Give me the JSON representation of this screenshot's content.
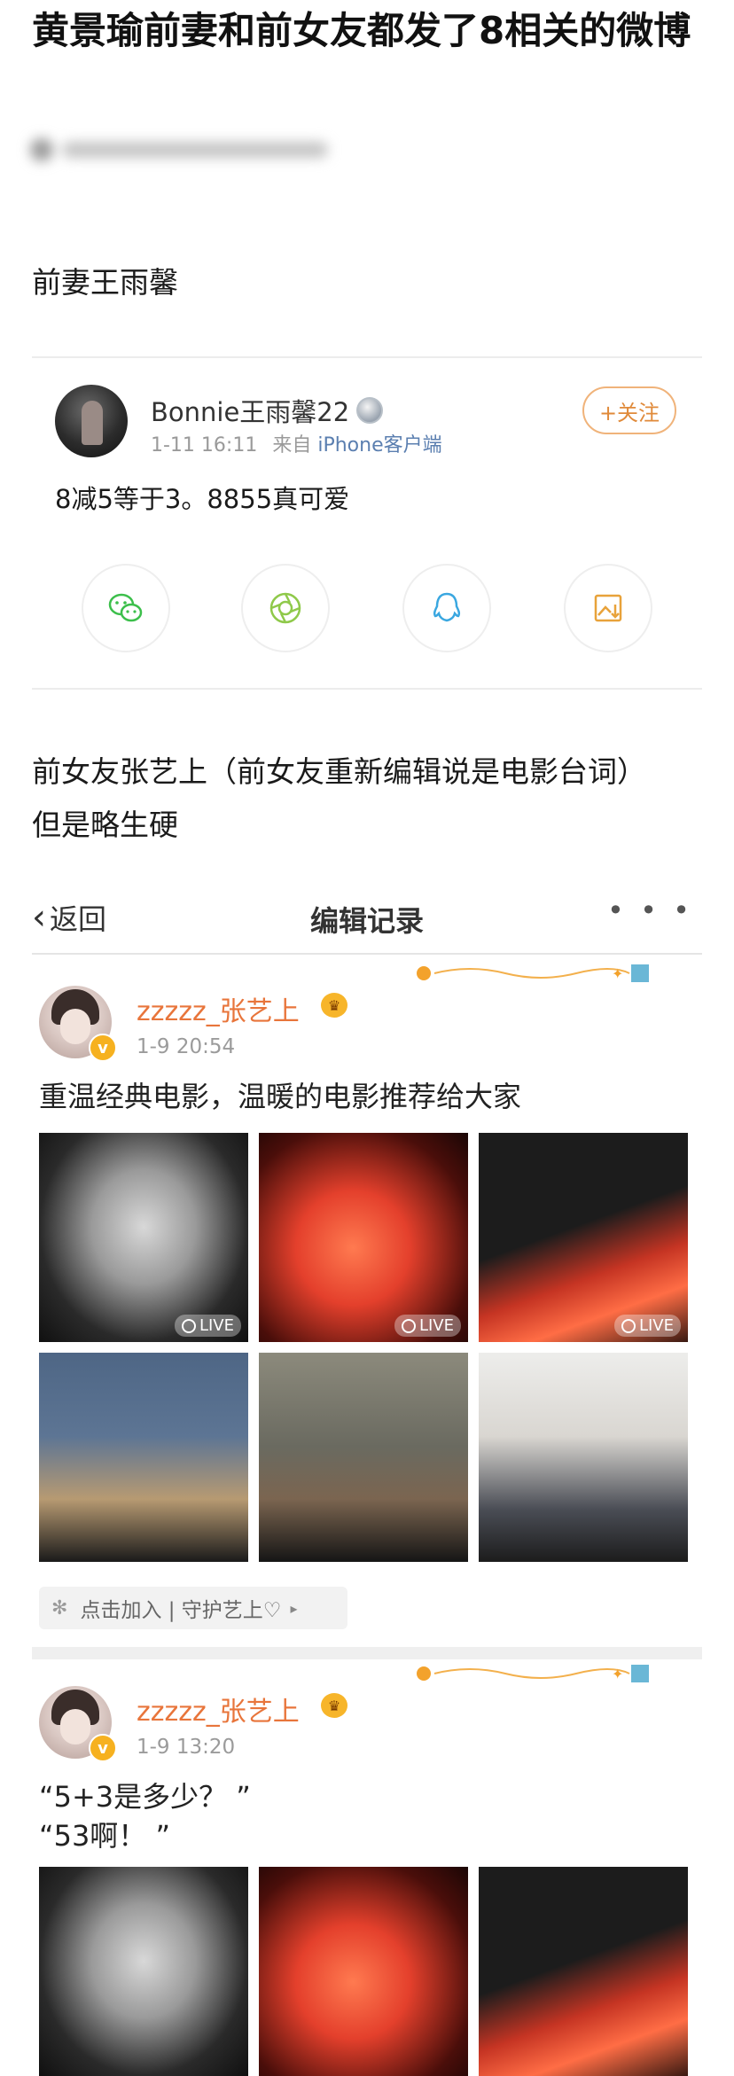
{
  "article": {
    "title": "黄景瑜前妻和前女友都发了8相关的微博",
    "section1": "前妻王雨馨",
    "section2_line1": "前女友张艺上（前女友重新编辑说是电影台词）",
    "section2_line2": "但是略生硬"
  },
  "bonnie_post": {
    "username": "Bonnie王雨馨22",
    "time": "1-11 16:11",
    "source_prefix": "来自",
    "source": "iPhone客户端",
    "follow_label": "+关注",
    "text": "8减5等于3。8855真可爱",
    "share_icons": [
      "wechat-icon",
      "moments-icon",
      "qq-icon",
      "save-image-icon"
    ]
  },
  "edit_history": {
    "back_label": "返回",
    "title": "编辑记录",
    "more_label": "• • •",
    "posts": [
      {
        "username": "zzzzz_张艺上",
        "time": "1-9 20:54",
        "text": "重温经典电影，温暖的电影推荐给大家",
        "live_label": "LIVE",
        "fan_bar": "点击加入 | 守护艺上♡"
      },
      {
        "username": "zzzzz_张艺上",
        "time": "1-9 13:20",
        "text_line1": "“5+3是多少？ ”",
        "text_line2": "“53啊！ ”"
      }
    ]
  },
  "colors": {
    "username_orange": "#e8753b",
    "follow_orange": "#e08a3a",
    "source_blue": "#5b7fb0",
    "verified_gold": "#f6b120"
  }
}
